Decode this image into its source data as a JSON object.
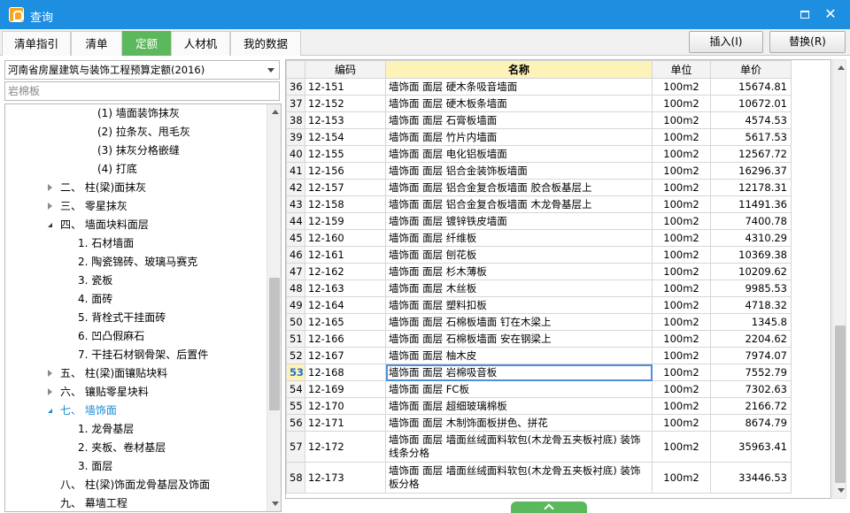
{
  "window": {
    "title": "查询",
    "restore_symbol": "▫",
    "close_symbol": "✕"
  },
  "tabs": [
    {
      "label": "清单指引",
      "active": false
    },
    {
      "label": "清单",
      "active": false
    },
    {
      "label": "定额",
      "active": true
    },
    {
      "label": "人材机",
      "active": false
    },
    {
      "label": "我的数据",
      "active": false
    }
  ],
  "actions": {
    "insert": "插入(I)",
    "replace": "替换(R)"
  },
  "left": {
    "quota_library": "河南省房屋建筑与装饰工程预算定额(2016)",
    "search_placeholder": "岩棉板",
    "tree": [
      {
        "label": "(1) 墙面装饰抹灰",
        "level": 3,
        "toggle": "none"
      },
      {
        "label": "(2) 拉条灰、甩毛灰",
        "level": 3,
        "toggle": "none"
      },
      {
        "label": "(3) 抹灰分格嵌缝",
        "level": 3,
        "toggle": "none"
      },
      {
        "label": "(4) 打底",
        "level": 3,
        "toggle": "none"
      },
      {
        "label": "二、 柱(梁)面抹灰",
        "level": 1,
        "toggle": "collapsed"
      },
      {
        "label": "三、 零星抹灰",
        "level": 1,
        "toggle": "collapsed"
      },
      {
        "label": "四、 墙面块料面层",
        "level": 1,
        "toggle": "expanded"
      },
      {
        "label": "1. 石材墙面",
        "level": 2,
        "toggle": "none"
      },
      {
        "label": "2. 陶瓷锦砖、玻璃马赛克",
        "level": 2,
        "toggle": "none"
      },
      {
        "label": "3. 瓷板",
        "level": 2,
        "toggle": "none"
      },
      {
        "label": "4. 面砖",
        "level": 2,
        "toggle": "none"
      },
      {
        "label": "5. 背栓式干挂面砖",
        "level": 2,
        "toggle": "none"
      },
      {
        "label": "6. 凹凸假麻石",
        "level": 2,
        "toggle": "none"
      },
      {
        "label": "7. 干挂石材钢骨架、后置件",
        "level": 2,
        "toggle": "none"
      },
      {
        "label": "五、 柱(梁)面镶贴块料",
        "level": 1,
        "toggle": "collapsed"
      },
      {
        "label": "六、 镶贴零星块料",
        "level": 1,
        "toggle": "collapsed"
      },
      {
        "label": "七、 墙饰面",
        "level": 1,
        "toggle": "expanded",
        "selected": true
      },
      {
        "label": "1. 龙骨基层",
        "level": 2,
        "toggle": "none"
      },
      {
        "label": "2. 夹板、卷材基层",
        "level": 2,
        "toggle": "none"
      },
      {
        "label": "3. 面层",
        "level": 2,
        "toggle": "none"
      },
      {
        "label": "八、 柱(梁)饰面龙骨基层及饰面",
        "level": 1,
        "toggle": "none"
      },
      {
        "label": "九、 幕墙工程",
        "level": 1,
        "toggle": "none"
      }
    ]
  },
  "grid": {
    "columns": [
      "",
      "编码",
      "名称",
      "单位",
      "单价"
    ],
    "current_row": "53",
    "rows": [
      {
        "no": "36",
        "code": "12-151",
        "name": "墙饰面 面层 硬木条吸音墙面",
        "unit": "100m2",
        "price": "15674.81"
      },
      {
        "no": "37",
        "code": "12-152",
        "name": "墙饰面 面层 硬木板条墙面",
        "unit": "100m2",
        "price": "10672.01"
      },
      {
        "no": "38",
        "code": "12-153",
        "name": "墙饰面 面层 石膏板墙面",
        "unit": "100m2",
        "price": "4574.53"
      },
      {
        "no": "39",
        "code": "12-154",
        "name": "墙饰面 面层 竹片内墙面",
        "unit": "100m2",
        "price": "5617.53"
      },
      {
        "no": "40",
        "code": "12-155",
        "name": "墙饰面 面层 电化铝板墙面",
        "unit": "100m2",
        "price": "12567.72"
      },
      {
        "no": "41",
        "code": "12-156",
        "name": "墙饰面 面层 铝合金装饰板墙面",
        "unit": "100m2",
        "price": "16296.37"
      },
      {
        "no": "42",
        "code": "12-157",
        "name": "墙饰面 面层 铝合金复合板墙面 胶合板基层上",
        "unit": "100m2",
        "price": "12178.31"
      },
      {
        "no": "43",
        "code": "12-158",
        "name": "墙饰面 面层 铝合金复合板墙面 木龙骨基层上",
        "unit": "100m2",
        "price": "11491.36"
      },
      {
        "no": "44",
        "code": "12-159",
        "name": "墙饰面 面层 镀锌铁皮墙面",
        "unit": "100m2",
        "price": "7400.78"
      },
      {
        "no": "45",
        "code": "12-160",
        "name": "墙饰面 面层 纤维板",
        "unit": "100m2",
        "price": "4310.29"
      },
      {
        "no": "46",
        "code": "12-161",
        "name": "墙饰面 面层 刨花板",
        "unit": "100m2",
        "price": "10369.38"
      },
      {
        "no": "47",
        "code": "12-162",
        "name": "墙饰面 面层 杉木薄板",
        "unit": "100m2",
        "price": "10209.62"
      },
      {
        "no": "48",
        "code": "12-163",
        "name": "墙饰面 面层 木丝板",
        "unit": "100m2",
        "price": "9985.53"
      },
      {
        "no": "49",
        "code": "12-164",
        "name": "墙饰面 面层 塑料扣板",
        "unit": "100m2",
        "price": "4718.32"
      },
      {
        "no": "50",
        "code": "12-165",
        "name": "墙饰面 面层 石棉板墙面 钉在木梁上",
        "unit": "100m2",
        "price": "1345.8"
      },
      {
        "no": "51",
        "code": "12-166",
        "name": "墙饰面 面层 石棉板墙面 安在钢梁上",
        "unit": "100m2",
        "price": "2204.62"
      },
      {
        "no": "52",
        "code": "12-167",
        "name": "墙饰面 面层 柚木皮",
        "unit": "100m2",
        "price": "7974.07"
      },
      {
        "no": "53",
        "code": "12-168",
        "name": "墙饰面 面层 岩棉吸音板",
        "unit": "100m2",
        "price": "7552.79"
      },
      {
        "no": "54",
        "code": "12-169",
        "name": "墙饰面 面层 FC板",
        "unit": "100m2",
        "price": "7302.63"
      },
      {
        "no": "55",
        "code": "12-170",
        "name": "墙饰面 面层 超细玻璃棉板",
        "unit": "100m2",
        "price": "2166.72"
      },
      {
        "no": "56",
        "code": "12-171",
        "name": "墙饰面 面层 木制饰面板拼色、拼花",
        "unit": "100m2",
        "price": "8674.79"
      },
      {
        "no": "57",
        "code": "12-172",
        "name": "墙饰面 面层 墙面丝绒面料软包(木龙骨五夹板衬底) 装饰线条分格",
        "unit": "100m2",
        "price": "35963.41"
      },
      {
        "no": "58",
        "code": "12-173",
        "name": "墙饰面 面层 墙面丝绒面料软包(木龙骨五夹板衬底) 装饰板分格",
        "unit": "100m2",
        "price": "33446.53"
      }
    ]
  }
}
